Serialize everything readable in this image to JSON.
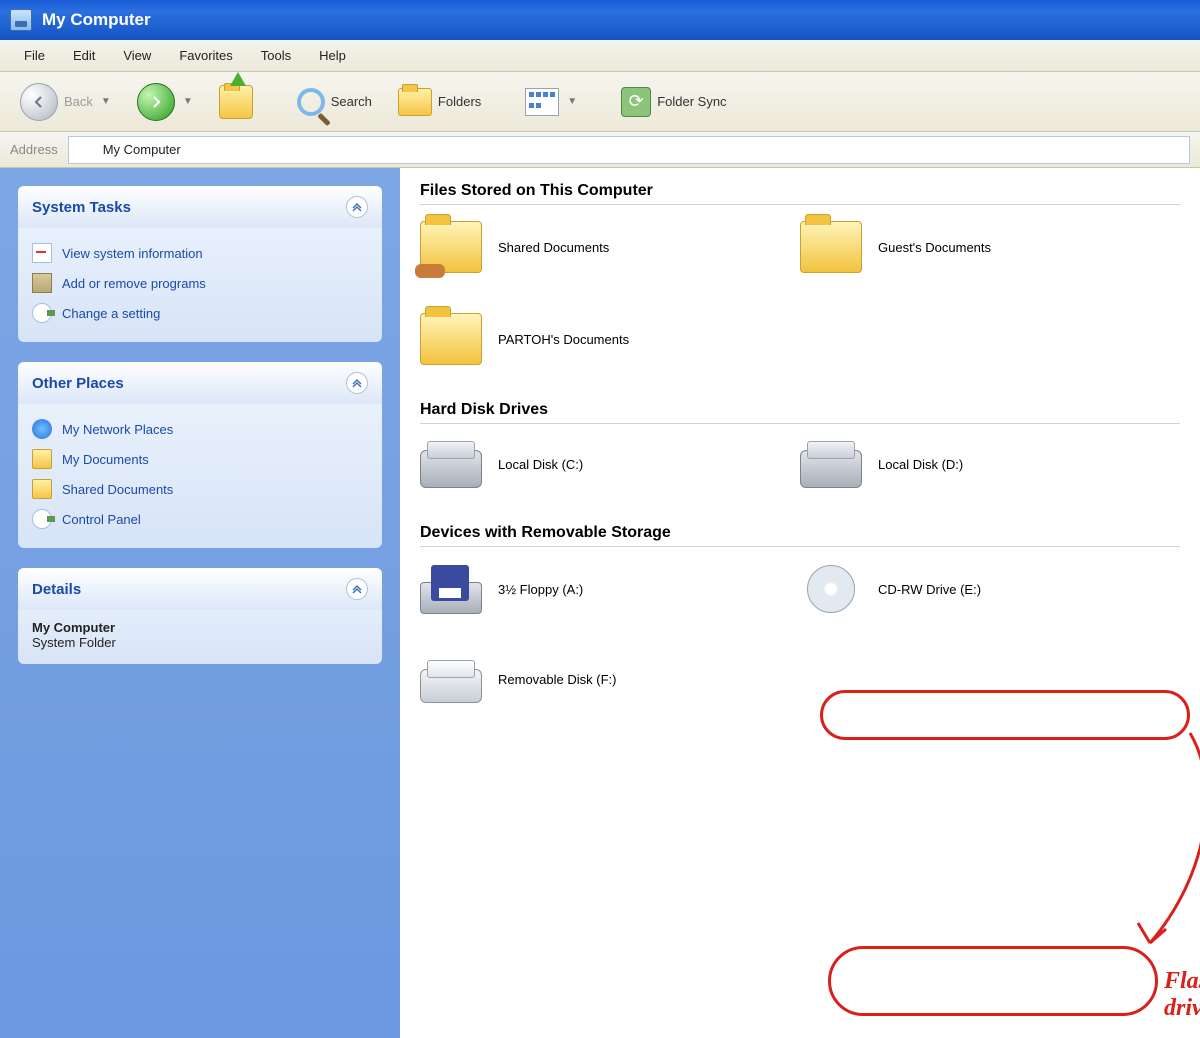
{
  "title": "My Computer",
  "menu": [
    "File",
    "Edit",
    "View",
    "Favorites",
    "Tools",
    "Help"
  ],
  "toolbar": {
    "back": "Back",
    "search": "Search",
    "folders": "Folders",
    "foldersync": "Folder Sync"
  },
  "address": {
    "label": "Address",
    "value": "My Computer"
  },
  "sidebar": {
    "panels": [
      {
        "title": "System Tasks",
        "items": [
          "View system information",
          "Add or remove programs",
          "Change a setting"
        ]
      },
      {
        "title": "Other Places",
        "items": [
          "My Network Places",
          "My Documents",
          "Shared Documents",
          "Control Panel"
        ]
      },
      {
        "title": "Details",
        "detail_title": "My Computer",
        "detail_sub": "System Folder"
      }
    ]
  },
  "content": {
    "groups": [
      {
        "heading": "Files Stored on This Computer",
        "items": [
          "Shared Documents",
          "Guest's Documents",
          "PARTOH's Documents"
        ]
      },
      {
        "heading": "Hard Disk Drives",
        "items": [
          "Local Disk (C:)",
          "Local Disk (D:)"
        ]
      },
      {
        "heading": "Devices with Removable Storage",
        "items": [
          "3½ Floppy (A:)",
          "CD-RW Drive (E:)",
          "Removable Disk (F:)"
        ]
      }
    ]
  },
  "annotation": {
    "text": "Flash drive"
  }
}
